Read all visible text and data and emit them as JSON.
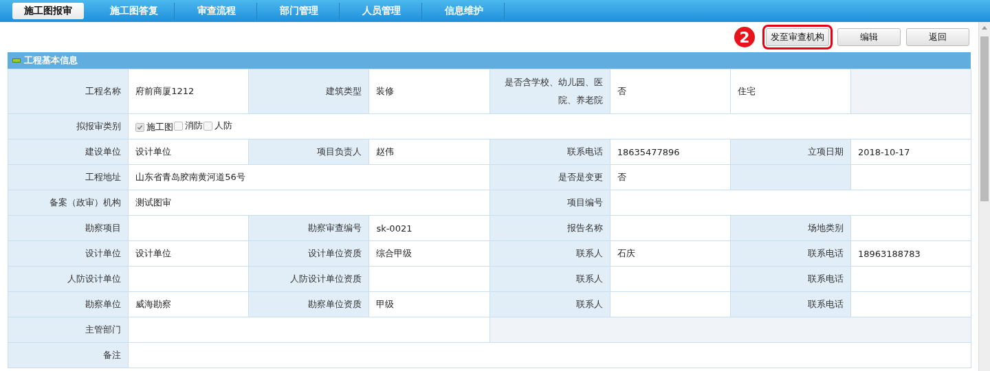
{
  "nav": {
    "tabs": [
      {
        "label": "施工图报审",
        "selected": true
      },
      {
        "label": "施工图答复",
        "selected": false
      },
      {
        "label": "审查流程",
        "selected": false
      },
      {
        "label": "部门管理",
        "selected": false
      },
      {
        "label": "人员管理",
        "selected": false
      },
      {
        "label": "信息维护",
        "selected": false
      }
    ]
  },
  "toolbar": {
    "callout": "2",
    "buttons": [
      {
        "label": "发至审查机构",
        "highlighted": true
      },
      {
        "label": "编辑",
        "highlighted": false
      },
      {
        "label": "返回",
        "highlighted": false
      }
    ]
  },
  "section": {
    "title": "工程基本信息",
    "expanded": true,
    "rows": [
      [
        {
          "kind": "label",
          "text": "工程名称"
        },
        {
          "kind": "value",
          "text": "府前商厦1212"
        },
        {
          "kind": "label",
          "text": "建筑类型"
        },
        {
          "kind": "value",
          "text": "装修"
        },
        {
          "kind": "label",
          "text": "是否含学校、幼儿园、医院、养老院"
        },
        {
          "kind": "value",
          "text": "否"
        },
        {
          "kind": "value",
          "text": "住宅"
        },
        {
          "kind": "blank"
        }
      ],
      [
        {
          "kind": "label",
          "text": "拟报审类别"
        },
        {
          "kind": "checks",
          "colspan": 7,
          "items": [
            {
              "label": "施工图",
              "checked": true,
              "disabled": true
            },
            {
              "label": "消防",
              "checked": false,
              "disabled": false
            },
            {
              "label": "人防",
              "checked": false,
              "disabled": false
            }
          ]
        }
      ],
      [
        {
          "kind": "label",
          "text": "建设单位"
        },
        {
          "kind": "value",
          "text": "设计单位"
        },
        {
          "kind": "label",
          "text": "项目负责人"
        },
        {
          "kind": "value",
          "text": "赵伟"
        },
        {
          "kind": "label",
          "text": "联系电话"
        },
        {
          "kind": "value",
          "text": "18635477896"
        },
        {
          "kind": "label",
          "text": "立项日期"
        },
        {
          "kind": "value",
          "text": "2018-10-17"
        }
      ],
      [
        {
          "kind": "label",
          "text": "工程地址"
        },
        {
          "kind": "value",
          "text": "山东省青岛胶南黄河道56号",
          "colspan": 3
        },
        {
          "kind": "label",
          "text": "是否是变更"
        },
        {
          "kind": "value",
          "text": "否"
        },
        {
          "kind": "label"
        },
        {
          "kind": "value"
        }
      ],
      [
        {
          "kind": "label",
          "text": "备案（政审）机构"
        },
        {
          "kind": "value",
          "text": "测试图审",
          "colspan": 3
        },
        {
          "kind": "label",
          "text": "项目编号"
        },
        {
          "kind": "value",
          "colspan": 3
        }
      ],
      [
        {
          "kind": "label",
          "text": "勘察项目"
        },
        {
          "kind": "value"
        },
        {
          "kind": "label",
          "text": "勘察审查编号"
        },
        {
          "kind": "value",
          "text": "sk-0021"
        },
        {
          "kind": "label",
          "text": "报告名称"
        },
        {
          "kind": "value"
        },
        {
          "kind": "label",
          "text": "场地类别"
        },
        {
          "kind": "value"
        }
      ],
      [
        {
          "kind": "label",
          "text": "设计单位"
        },
        {
          "kind": "value",
          "text": "设计单位"
        },
        {
          "kind": "label",
          "text": "设计单位资质"
        },
        {
          "kind": "value",
          "text": "综合甲级"
        },
        {
          "kind": "label",
          "text": "联系人"
        },
        {
          "kind": "value",
          "text": "石庆"
        },
        {
          "kind": "label",
          "text": "联系电话"
        },
        {
          "kind": "value",
          "text": "18963188783"
        }
      ],
      [
        {
          "kind": "label",
          "text": "人防设计单位"
        },
        {
          "kind": "value"
        },
        {
          "kind": "label",
          "text": "人防设计单位资质"
        },
        {
          "kind": "value"
        },
        {
          "kind": "label",
          "text": "联系人"
        },
        {
          "kind": "value"
        },
        {
          "kind": "label",
          "text": "联系电话"
        },
        {
          "kind": "value"
        }
      ],
      [
        {
          "kind": "label",
          "text": "勘察单位"
        },
        {
          "kind": "value",
          "text": "威海勘察"
        },
        {
          "kind": "label",
          "text": "勘察单位资质"
        },
        {
          "kind": "value",
          "text": "甲级"
        },
        {
          "kind": "label",
          "text": "联系人"
        },
        {
          "kind": "value"
        },
        {
          "kind": "label",
          "text": "联系电话"
        },
        {
          "kind": "value"
        }
      ],
      [
        {
          "kind": "label",
          "text": "主管部门"
        },
        {
          "kind": "value",
          "colspan": 3
        },
        {
          "kind": "blank",
          "colspan": 4
        }
      ],
      [
        {
          "kind": "label",
          "text": "备注"
        },
        {
          "kind": "value",
          "colspan": 7
        }
      ]
    ]
  }
}
